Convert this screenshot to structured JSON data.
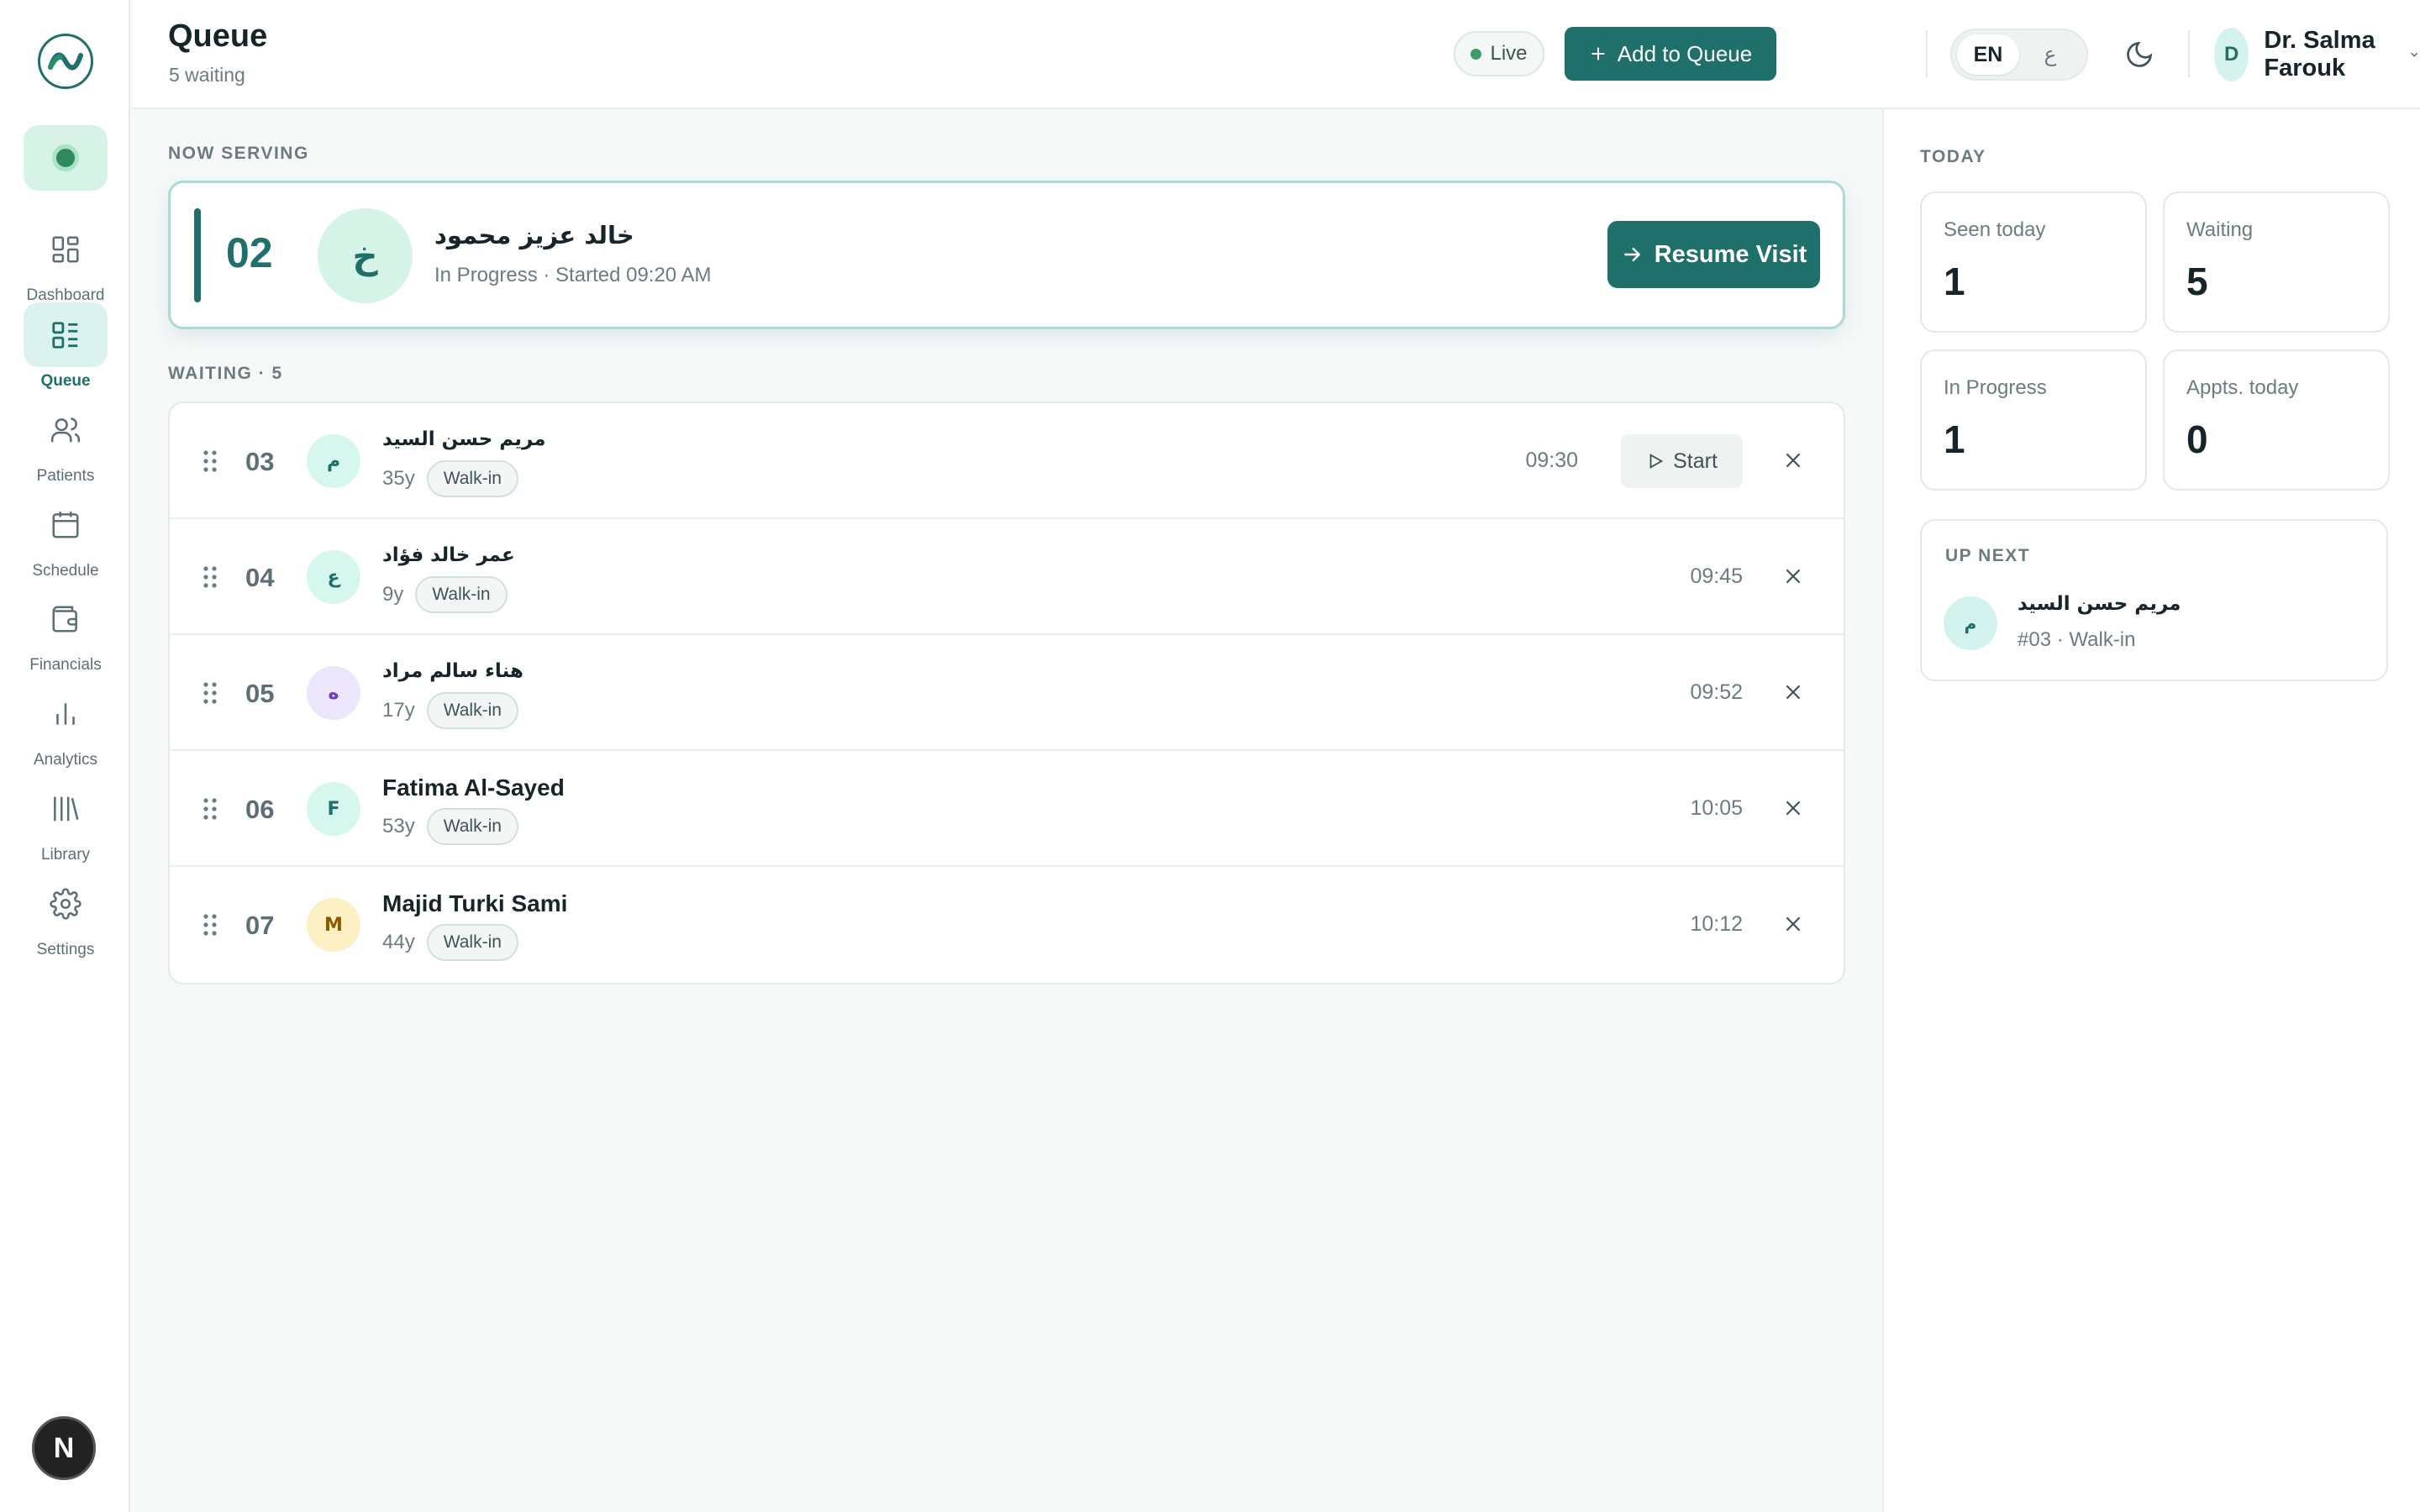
{
  "sidebar": {
    "items": [
      {
        "label": "Dashboard",
        "icon": "dashboard-icon"
      },
      {
        "label": "Queue",
        "icon": "queue-list-icon",
        "active": true
      },
      {
        "label": "Patients",
        "icon": "users-icon"
      },
      {
        "label": "Schedule",
        "icon": "calendar-icon"
      },
      {
        "label": "Financials",
        "icon": "wallet-icon"
      },
      {
        "label": "Analytics",
        "icon": "bar-chart-icon"
      },
      {
        "label": "Library",
        "icon": "library-icon"
      },
      {
        "label": "Settings",
        "icon": "gear-icon"
      }
    ],
    "bottom_avatar": "N"
  },
  "header": {
    "title": "Queue",
    "subtitle": "5 waiting",
    "live_label": "Live",
    "add_button": "Add to Queue",
    "lang_en": "EN",
    "lang_ar": "ع",
    "user_initial": "D",
    "user_name": "Dr. Salma Farouk"
  },
  "now_serving": {
    "section_label": "NOW SERVING",
    "number": "02",
    "initial": "خ",
    "name": "خالد عزيز محمود",
    "status": "In Progress · Started 09:20 AM",
    "resume_label": "Resume Visit"
  },
  "waiting": {
    "section_label": "WAITING · 5",
    "start_label": "Start",
    "rows": [
      {
        "num": "03",
        "initial": "م",
        "name": "مريم حسن السيد",
        "age": "35y",
        "type": "Walk-in",
        "time": "09:30",
        "avatar_bg": "#d5f7ee",
        "avatar_fg": "#1f6f6a"
      },
      {
        "num": "04",
        "initial": "ع",
        "name": "عمر خالد فؤاد",
        "age": "9y",
        "type": "Walk-in",
        "time": "09:45",
        "avatar_bg": "#d5f7ee",
        "avatar_fg": "#1f6f6a"
      },
      {
        "num": "05",
        "initial": "ه",
        "name": "هناء سالم مراد",
        "age": "17y",
        "type": "Walk-in",
        "time": "09:52",
        "avatar_bg": "#ece6fb",
        "avatar_fg": "#6b3fc4"
      },
      {
        "num": "06",
        "initial": "F",
        "name": "Fatima Al-Sayed",
        "age": "53y",
        "type": "Walk-in",
        "time": "10:05",
        "avatar_bg": "#d5f7ee",
        "avatar_fg": "#1f6f6a"
      },
      {
        "num": "07",
        "initial": "M",
        "name": "Majid Turki Sami",
        "age": "44y",
        "type": "Walk-in",
        "time": "10:12",
        "avatar_bg": "#fdf0c4",
        "avatar_fg": "#8a5a00"
      }
    ]
  },
  "today": {
    "section_label": "TODAY",
    "stats": [
      {
        "label": "Seen today",
        "value": "1"
      },
      {
        "label": "Waiting",
        "value": "5"
      },
      {
        "label": "In Progress",
        "value": "1"
      },
      {
        "label": "Appts. today",
        "value": "0"
      }
    ],
    "up_next": {
      "label": "UP NEXT",
      "initial": "م",
      "name": "مريم حسن السيد",
      "meta": "#03 · Walk-in"
    }
  },
  "colors": {
    "accent": "#1f6f6a",
    "live_dot": "#3c9d6a"
  }
}
